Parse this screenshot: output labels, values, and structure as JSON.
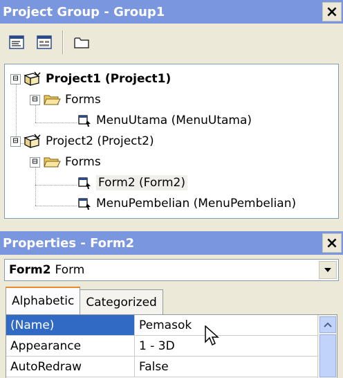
{
  "project_group": {
    "title": "Project Group - Group1",
    "close_label": "×",
    "toolbar": {
      "icons": [
        "view-code-icon",
        "view-object-icon",
        "toggle-folders-icon"
      ]
    },
    "tree": [
      {
        "label": "Project1 (Project1)",
        "bold": true
      },
      {
        "label": "Forms"
      },
      {
        "label": "MenuUtama (MenuUtama)"
      },
      {
        "label": "Project2 (Project2)"
      },
      {
        "label": "Forms"
      },
      {
        "label": "Form2 (Form2)",
        "selected": true
      },
      {
        "label": "MenuPembelian (MenuPembelian)"
      }
    ],
    "expanders": [
      "⊟",
      "⊟",
      "⊟",
      "⊟"
    ]
  },
  "properties": {
    "title": "Properties - Form2",
    "close_label": "×",
    "object": {
      "name": "Form2",
      "type": "Form"
    },
    "tabs": [
      {
        "label": "Alphabetic",
        "active": true
      },
      {
        "label": "Categorized",
        "active": false
      }
    ],
    "rows": [
      {
        "name": "(Name)",
        "value": "Pemasok",
        "selected": true
      },
      {
        "name": "Appearance",
        "value": "1 - 3D"
      },
      {
        "name": "AutoRedraw",
        "value": "False"
      }
    ]
  },
  "colors": {
    "title_bar": "#7a96df",
    "selected_row": "#316ac5",
    "window_bg": "#ece9d8"
  }
}
